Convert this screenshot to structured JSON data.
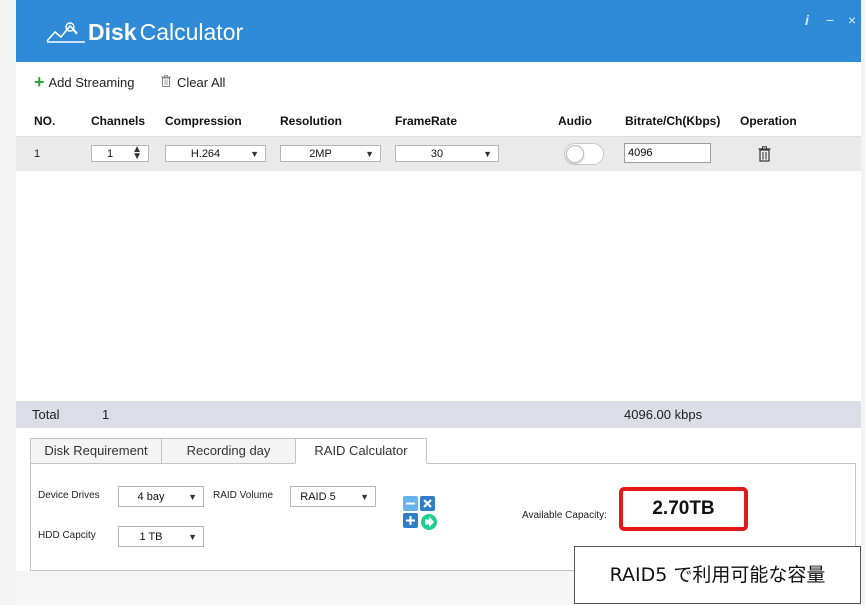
{
  "window": {
    "app_name_bold": "Disk",
    "app_name_light": "Calculator",
    "info_glyph": "i",
    "minimize_glyph": "−",
    "close_glyph": "×",
    "titlebar_color": "#2f8bd8"
  },
  "toolbar": {
    "add_label": "Add Streaming",
    "clear_label": "Clear All",
    "add_icon": "plus-icon",
    "clear_icon": "trash-icon"
  },
  "table": {
    "headers": [
      "NO.",
      "Channels",
      "Compression",
      "Resolution",
      "FrameRate",
      "Audio",
      "Bitrate/Ch(Kbps)",
      "Operation"
    ],
    "rows": [
      {
        "no": "1",
        "channels": "1",
        "compression": "H.264",
        "resolution": "2MP",
        "framerate": "30",
        "audio_on": false,
        "bitrate": "4096",
        "operation_icon": "delete-icon"
      }
    ]
  },
  "total": {
    "label": "Total",
    "channels": "1",
    "bitrate": "4096.00 kbps"
  },
  "tabs": [
    {
      "label": "Disk Requirement",
      "active": false
    },
    {
      "label": "Recording day",
      "active": false
    },
    {
      "label": "RAID Calculator",
      "active": true
    }
  ],
  "raid": {
    "device_drives_label": "Device Drives",
    "device_drives_value": "4 bay",
    "raid_volume_label": "RAID Volume",
    "raid_volume_value": "RAID 5",
    "hdd_capacity_label": "HDD Capcity",
    "hdd_capacity_value": "1 TB",
    "calc_icon": "calculator-icon",
    "available_label": "Available Capacity:",
    "available_value": "2.70TB",
    "highlight_color": "#e31a1a"
  },
  "annotation": {
    "text": "RAID5 で利用可能な容量"
  }
}
